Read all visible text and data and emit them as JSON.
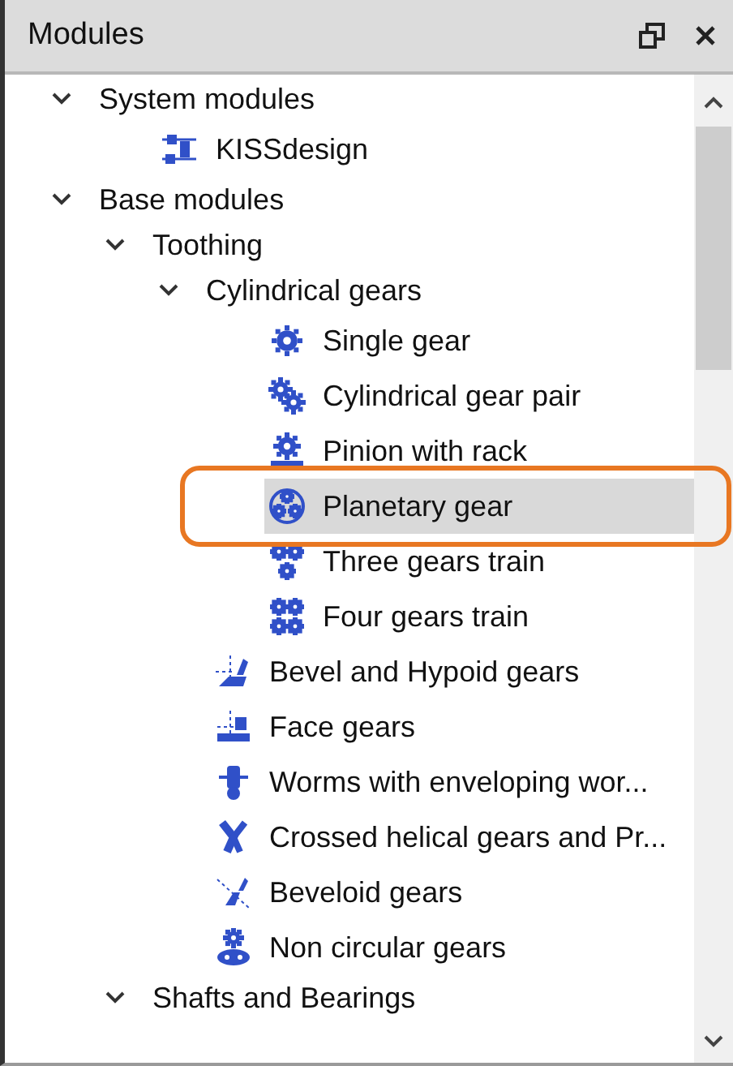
{
  "panel": {
    "title": "Modules"
  },
  "tree": [
    {
      "label": "System modules",
      "expanded": true,
      "children": [
        {
          "label": "KISSdesign",
          "selected": false
        }
      ]
    },
    {
      "label": "Base modules",
      "expanded": true,
      "children": [
        {
          "label": "Toothing",
          "expanded": true,
          "children": [
            {
              "label": "Cylindrical gears",
              "expanded": true,
              "children": [
                {
                  "label": "Single gear",
                  "selected": false
                },
                {
                  "label": "Cylindrical gear pair",
                  "selected": false
                },
                {
                  "label": "Pinion with rack",
                  "selected": false
                },
                {
                  "label": "Planetary gear",
                  "selected": true,
                  "highlighted": true
                },
                {
                  "label": "Three gears train",
                  "selected": false
                },
                {
                  "label": "Four gears train",
                  "selected": false
                }
              ]
            },
            {
              "label": "Bevel and Hypoid gears",
              "selected": false
            },
            {
              "label": "Face gears",
              "selected": false
            },
            {
              "label": "Worms with enveloping wor...",
              "selected": false
            },
            {
              "label": "Crossed helical gears and Pr...",
              "selected": false
            },
            {
              "label": "Beveloid gears",
              "selected": false
            },
            {
              "label": "Non circular gears",
              "selected": false
            }
          ]
        },
        {
          "label": "Shafts and Bearings",
          "expanded": true
        }
      ]
    }
  ]
}
